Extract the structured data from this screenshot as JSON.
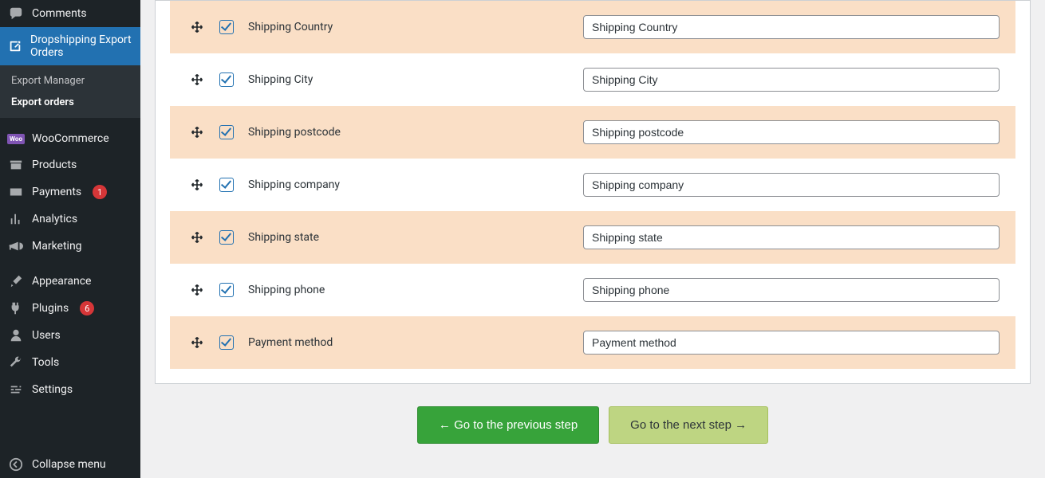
{
  "sidebar": {
    "comments": "Comments",
    "dropshipping": "Dropshipping Export Orders",
    "sub": {
      "manager": "Export Manager",
      "orders": "Export orders"
    },
    "woocommerce": "WooCommerce",
    "products": "Products",
    "payments": {
      "label": "Payments",
      "badge": "1"
    },
    "analytics": "Analytics",
    "marketing": "Marketing",
    "appearance": "Appearance",
    "plugins": {
      "label": "Plugins",
      "badge": "6"
    },
    "users": "Users",
    "tools": "Tools",
    "settings": "Settings",
    "collapse": "Collapse menu"
  },
  "fields": [
    {
      "label": "Shipping Country",
      "value": "Shipping Country"
    },
    {
      "label": "Shipping City",
      "value": "Shipping City"
    },
    {
      "label": "Shipping postcode",
      "value": "Shipping postcode"
    },
    {
      "label": "Shipping company",
      "value": "Shipping company"
    },
    {
      "label": "Shipping state",
      "value": "Shipping state"
    },
    {
      "label": "Shipping phone",
      "value": "Shipping phone"
    },
    {
      "label": "Payment method",
      "value": "Payment method"
    }
  ],
  "buttons": {
    "prev": "← Go to the previous step",
    "next": "Go to the next step →"
  }
}
